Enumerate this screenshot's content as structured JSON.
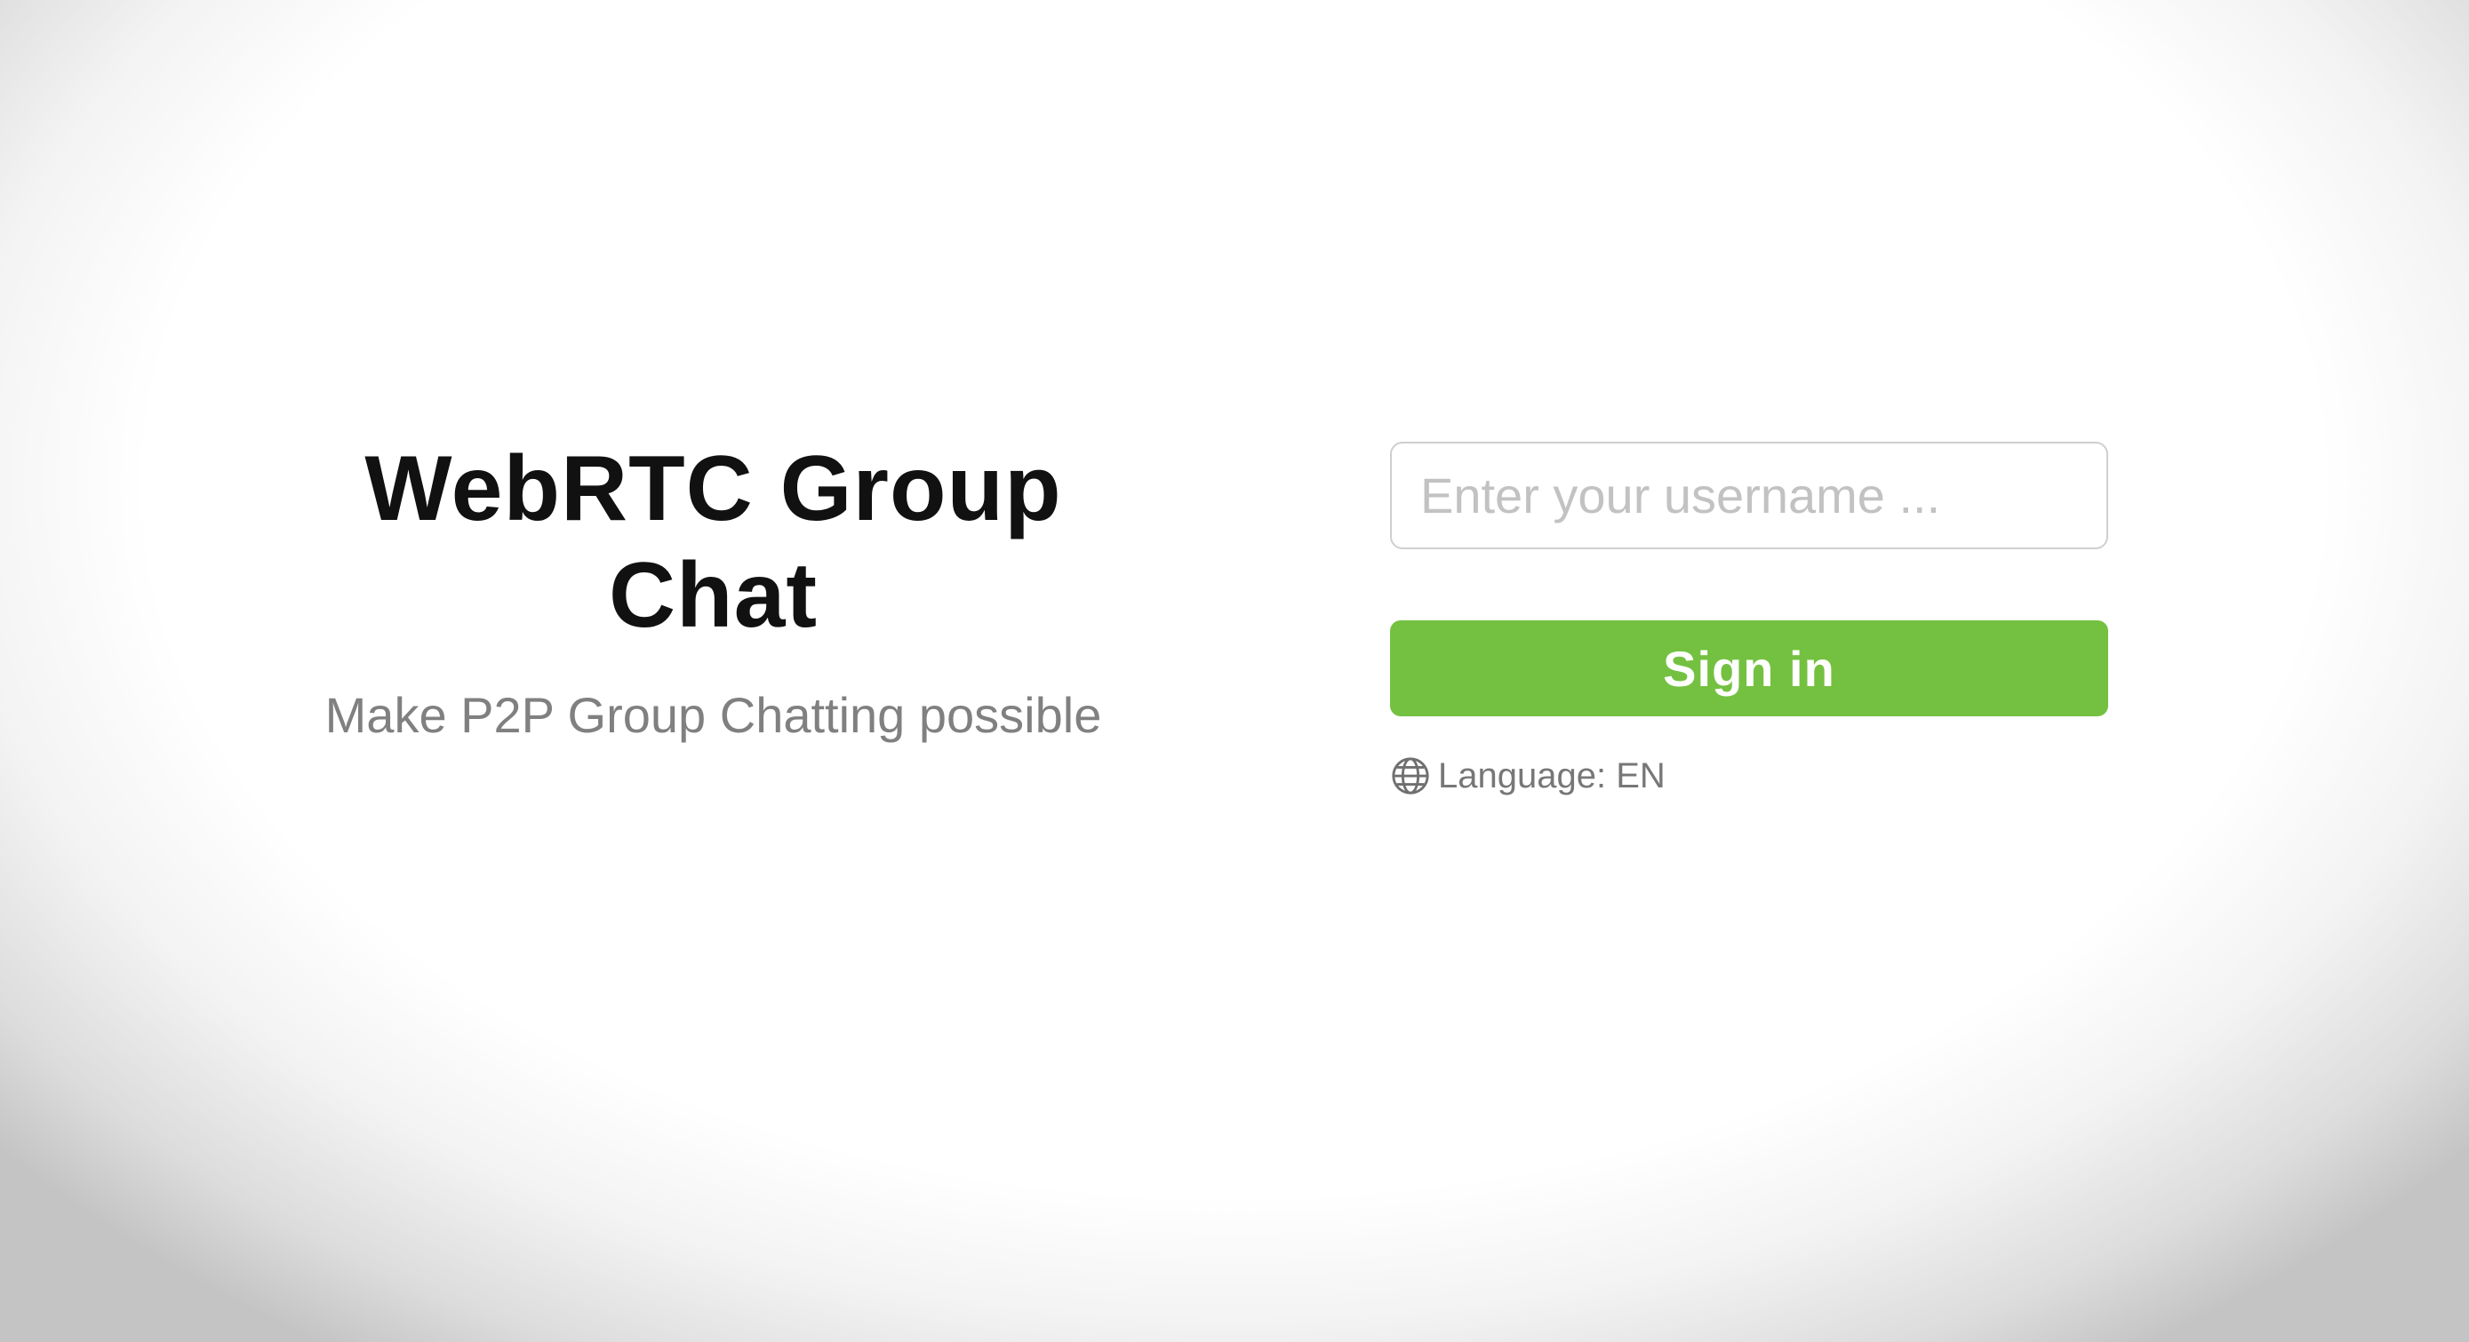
{
  "brand": {
    "title": "WebRTC Group Chat",
    "subtitle": "Make P2P Group Chatting possible"
  },
  "login": {
    "username_placeholder": "Enter your username ...",
    "username_value": "",
    "signin_label": "Sign in",
    "language_label": "Language: EN",
    "language_icon": "globe-icon"
  },
  "colors": {
    "accent": "#74c141",
    "title": "#111111",
    "subtitle": "#808080",
    "placeholder": "#c2c2c2"
  }
}
